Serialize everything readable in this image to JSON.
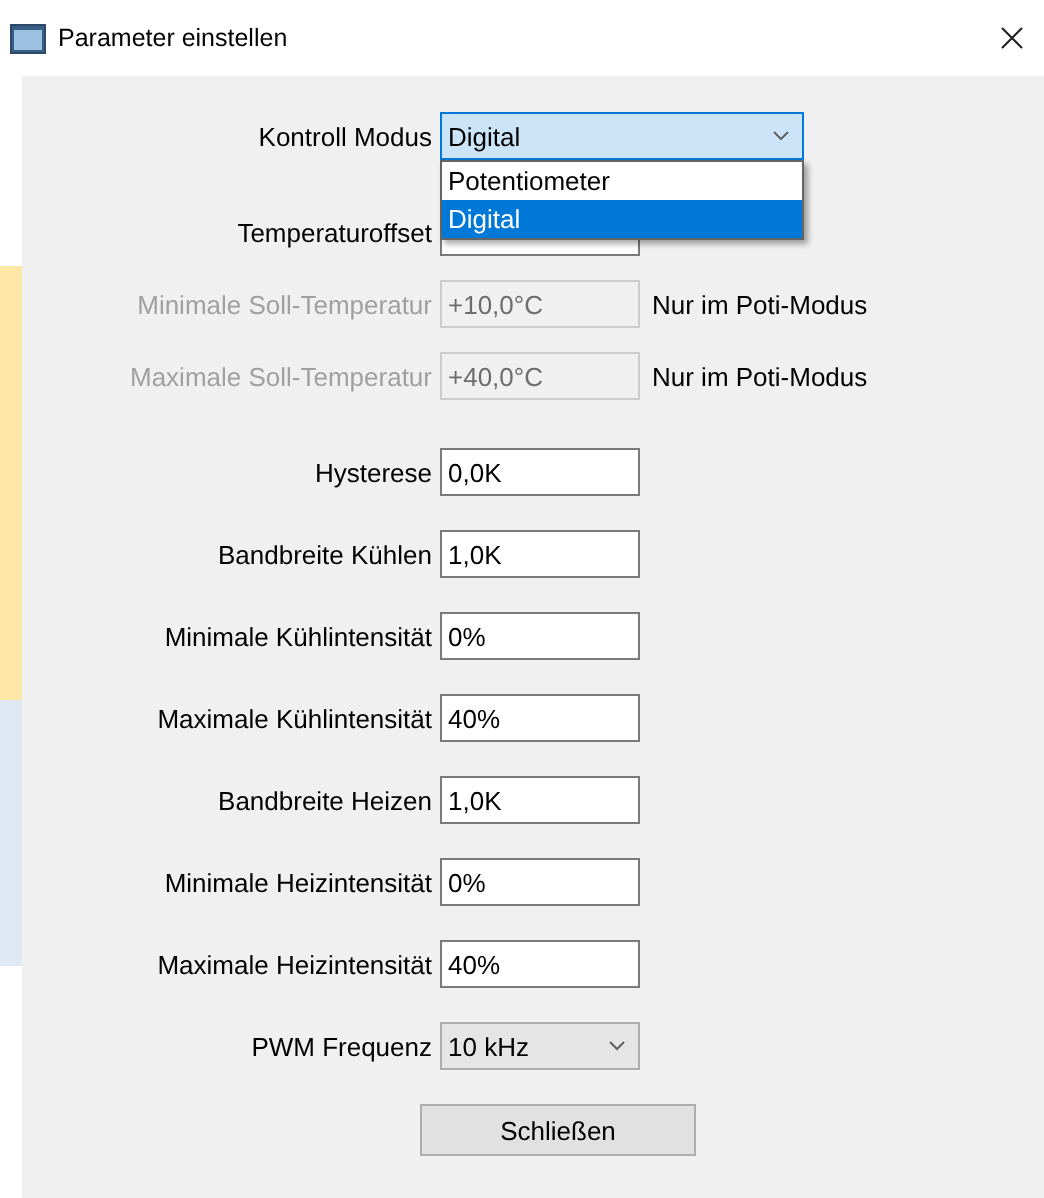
{
  "window": {
    "title": "Parameter einstellen"
  },
  "fields": [
    {
      "kind": "combo",
      "label": "Kontroll Modus",
      "value": "Digital",
      "focused": true,
      "expanded": true,
      "disabled": false,
      "options": [
        {
          "label": "Potentiometer",
          "selected": false
        },
        {
          "label": "Digital",
          "selected": true
        }
      ]
    },
    {
      "kind": "text",
      "label": "Temperaturoffset",
      "disabled": false
    },
    {
      "kind": "text",
      "label": "Minimale Soll-Temperatur",
      "value": "+10,0°C",
      "disabled": true,
      "note": "Nur im Poti-Modus"
    },
    {
      "kind": "text",
      "label": "Maximale Soll-Temperatur",
      "value": "+40,0°C",
      "disabled": true,
      "note": "Nur im Poti-Modus"
    },
    {
      "kind": "text",
      "label": "Hysterese",
      "value": "0,0K",
      "disabled": false
    },
    {
      "kind": "text",
      "label": "Bandbreite Kühlen",
      "value": "1,0K",
      "disabled": false
    },
    {
      "kind": "text",
      "label": "Minimale Kühlintensität",
      "value": "0%",
      "disabled": false
    },
    {
      "kind": "text",
      "label": "Maximale Kühlintensität",
      "value": "40%",
      "disabled": false
    },
    {
      "kind": "text",
      "label": "Bandbreite Heizen",
      "value": "1,0K",
      "disabled": false
    },
    {
      "kind": "text",
      "label": "Minimale Heizintensität",
      "value": "0%",
      "disabled": false
    },
    {
      "kind": "text",
      "label": "Maximale Heizintensität",
      "value": "40%",
      "disabled": false
    },
    {
      "kind": "combo",
      "label": "PWM Frequenz",
      "value": "10 kHz",
      "focused": false,
      "disabled": false
    }
  ],
  "buttons": [
    {
      "label": "Schließen"
    }
  ]
}
